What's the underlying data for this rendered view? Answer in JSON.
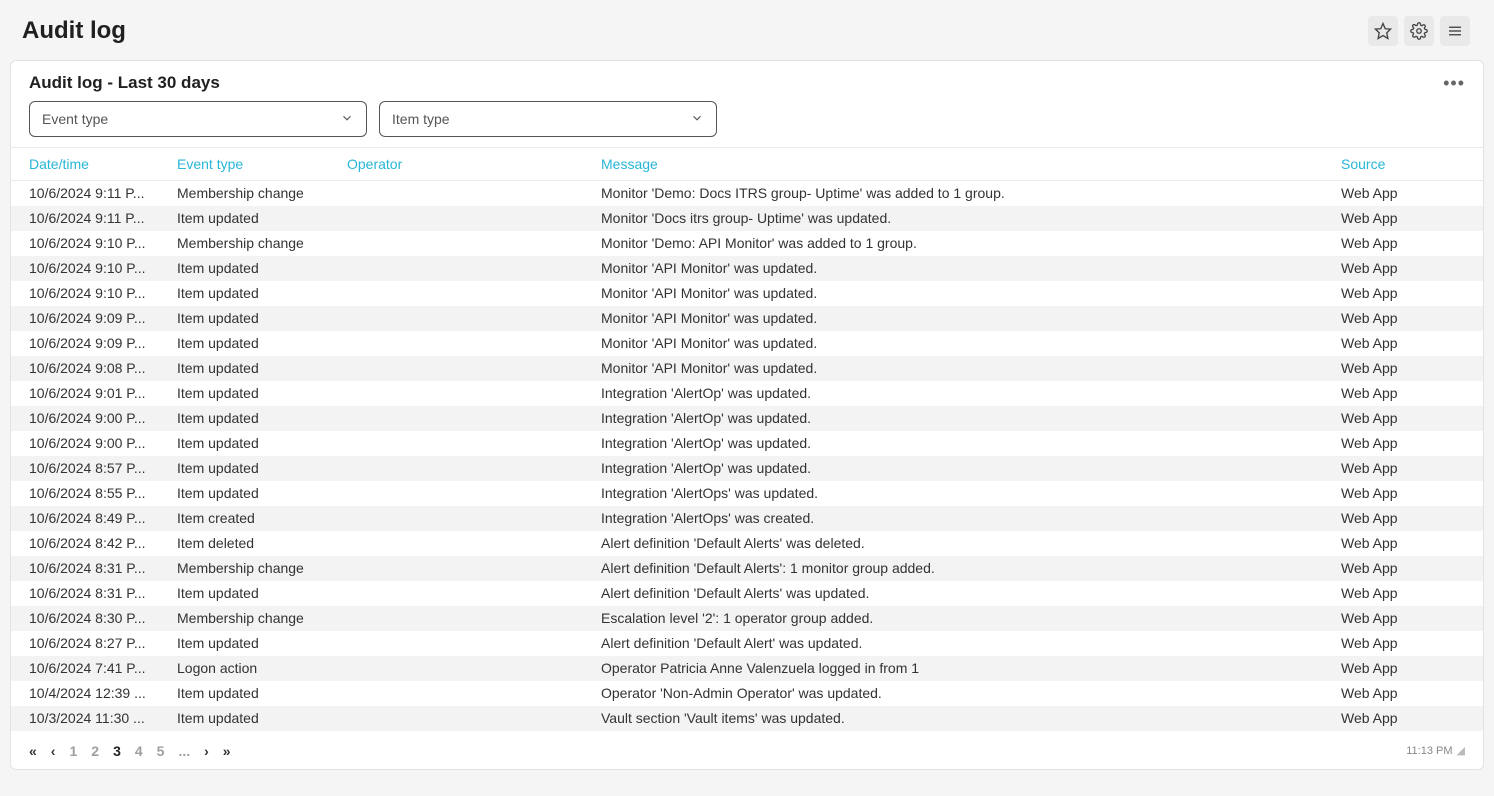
{
  "header": {
    "title": "Audit log"
  },
  "panel": {
    "title": "Audit log - Last 30 days"
  },
  "filters": {
    "event_type_placeholder": "Event type",
    "item_type_placeholder": "Item type"
  },
  "columns": {
    "datetime": "Date/time",
    "event_type": "Event type",
    "operator": "Operator",
    "message": "Message",
    "source": "Source"
  },
  "rows": [
    {
      "datetime": "10/6/2024 9:11 P...",
      "event": "Membership change",
      "operator": "",
      "message": "Monitor 'Demo: Docs ITRS group- Uptime' was added to 1 group.",
      "source": "Web App"
    },
    {
      "datetime": "10/6/2024 9:11 P...",
      "event": "Item updated",
      "operator": "",
      "message": "Monitor 'Docs itrs group- Uptime' was updated.",
      "source": "Web App"
    },
    {
      "datetime": "10/6/2024 9:10 P...",
      "event": "Membership change",
      "operator": "",
      "message": "Monitor 'Demo: API Monitor' was added to 1 group.",
      "source": "Web App"
    },
    {
      "datetime": "10/6/2024 9:10 P...",
      "event": "Item updated",
      "operator": "",
      "message": "Monitor 'API Monitor' was updated.",
      "source": "Web App"
    },
    {
      "datetime": "10/6/2024 9:10 P...",
      "event": "Item updated",
      "operator": "",
      "message": "Monitor 'API Monitor' was updated.",
      "source": "Web App"
    },
    {
      "datetime": "10/6/2024 9:09 P...",
      "event": "Item updated",
      "operator": "",
      "message": "Monitor 'API Monitor' was updated.",
      "source": "Web App"
    },
    {
      "datetime": "10/6/2024 9:09 P...",
      "event": "Item updated",
      "operator": "",
      "message": "Monitor 'API Monitor' was updated.",
      "source": "Web App"
    },
    {
      "datetime": "10/6/2024 9:08 P...",
      "event": "Item updated",
      "operator": "",
      "message": "Monitor 'API Monitor' was updated.",
      "source": "Web App"
    },
    {
      "datetime": "10/6/2024 9:01 P...",
      "event": "Item updated",
      "operator": "",
      "message": "Integration 'AlertOp' was updated.",
      "source": "Web App"
    },
    {
      "datetime": "10/6/2024 9:00 P...",
      "event": "Item updated",
      "operator": "",
      "message": "Integration 'AlertOp' was updated.",
      "source": "Web App"
    },
    {
      "datetime": "10/6/2024 9:00 P...",
      "event": "Item updated",
      "operator": "",
      "message": "Integration 'AlertOp' was updated.",
      "source": "Web App"
    },
    {
      "datetime": "10/6/2024 8:57 P...",
      "event": "Item updated",
      "operator": "",
      "message": "Integration 'AlertOp' was updated.",
      "source": "Web App"
    },
    {
      "datetime": "10/6/2024 8:55 P...",
      "event": "Item updated",
      "operator": "",
      "message": "Integration 'AlertOps' was updated.",
      "source": "Web App"
    },
    {
      "datetime": "10/6/2024 8:49 P...",
      "event": "Item created",
      "operator": "",
      "message": "Integration 'AlertOps' was created.",
      "source": "Web App"
    },
    {
      "datetime": "10/6/2024 8:42 P...",
      "event": "Item deleted",
      "operator": "",
      "message": "Alert definition 'Default Alerts' was deleted.",
      "source": "Web App"
    },
    {
      "datetime": "10/6/2024 8:31 P...",
      "event": "Membership change",
      "operator": "",
      "message": "Alert definition 'Default Alerts': 1 monitor group added.",
      "source": "Web App"
    },
    {
      "datetime": "10/6/2024 8:31 P...",
      "event": "Item updated",
      "operator": "",
      "message": "Alert definition 'Default Alerts' was updated.",
      "source": "Web App"
    },
    {
      "datetime": "10/6/2024 8:30 P...",
      "event": "Membership change",
      "operator": "",
      "message": "Escalation level '2': 1 operator group added.",
      "source": "Web App"
    },
    {
      "datetime": "10/6/2024 8:27 P...",
      "event": "Item updated",
      "operator": "",
      "message": "Alert definition 'Default Alert' was updated.",
      "source": "Web App"
    },
    {
      "datetime": "10/6/2024 7:41 P...",
      "event": "Logon action",
      "operator": "",
      "message": "Operator Patricia Anne Valenzuela logged in from 1",
      "source": "Web App"
    },
    {
      "datetime": "10/4/2024 12:39 ...",
      "event": "Item updated",
      "operator": "",
      "message": "Operator 'Non-Admin Operator' was updated.",
      "source": "Web App"
    },
    {
      "datetime": "10/3/2024 11:30 ...",
      "event": "Item updated",
      "operator": "",
      "message": "Vault section 'Vault items' was updated.",
      "source": "Web App"
    }
  ],
  "pagination": {
    "pages": [
      "1",
      "2",
      "3",
      "4",
      "5",
      "..."
    ],
    "active": "3"
  },
  "clock": "11:13 PM"
}
